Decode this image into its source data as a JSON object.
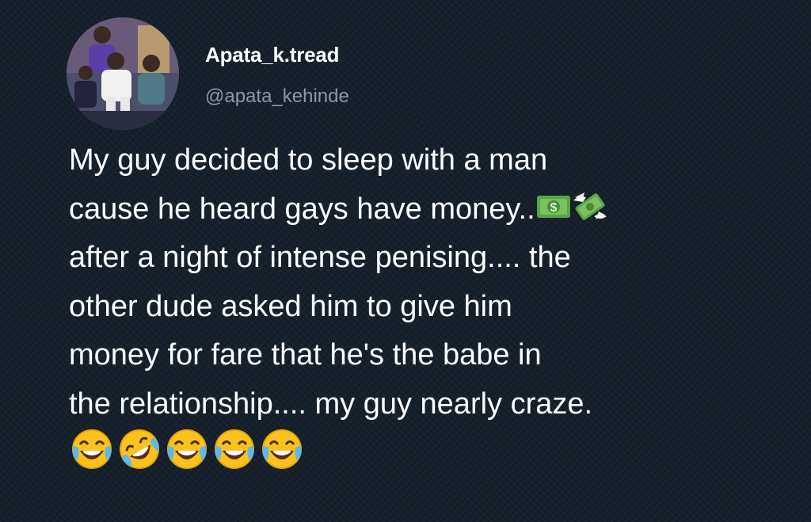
{
  "tweet": {
    "author": {
      "display_name": "Apata_k.tread",
      "handle": "@apata_kehinde",
      "avatar_icon": "profile-photo"
    },
    "text_lines": [
      "My guy decided to sleep with a man",
      "cause he heard gays have money..",
      "after a night of intense penising.... the",
      "other dude asked him to give him",
      "money for fare that he's the babe in",
      "the relationship.... my guy nearly craze."
    ],
    "inline_emojis": [
      "dollar-banknote-emoji",
      "money-with-wings-emoji"
    ],
    "trailing_emojis": [
      "tears-of-joy-emoji",
      "rolling-on-floor-laughing-emoji",
      "tears-of-joy-emoji",
      "tears-of-joy-emoji",
      "tears-of-joy-emoji"
    ]
  },
  "colors": {
    "background": "#15202b",
    "name": "#ffffff",
    "handle": "#8b98a5",
    "text": "#ffffff"
  }
}
